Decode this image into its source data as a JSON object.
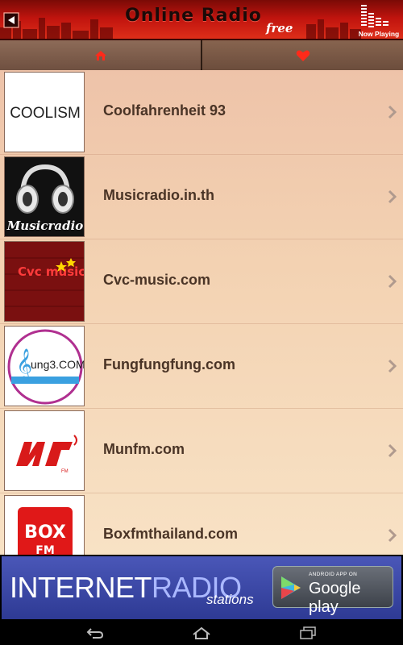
{
  "header": {
    "title": "Online Radio",
    "subtitle": "free",
    "now_playing_label": "Now Playing",
    "back_icon": "back-icon"
  },
  "tabs": [
    {
      "icon": "home-icon"
    },
    {
      "icon": "heart-icon"
    }
  ],
  "stations": [
    {
      "label": "Coolfahrenheit 93",
      "logo_text": "COOLISM"
    },
    {
      "label": "Musicradio.in.th",
      "logo_text": "Musicradio"
    },
    {
      "label": "Cvc-music.com",
      "logo_text": "Cvc music"
    },
    {
      "label": "Fungfungfung.com",
      "logo_text": "ung3.COM"
    },
    {
      "label": "Munfm.com",
      "logo_text": "MUNFM"
    },
    {
      "label": "Boxfmthailand.com",
      "logo_text": "BOX FM"
    }
  ],
  "ad": {
    "title_part1": "INTERNET",
    "title_part2": "RADIO",
    "subtitle": "stations",
    "store_small": "ANDROID APP ON",
    "store_big": "Google play"
  },
  "navbar": [
    "back-nav-icon",
    "home-nav-icon",
    "recent-apps-icon"
  ]
}
